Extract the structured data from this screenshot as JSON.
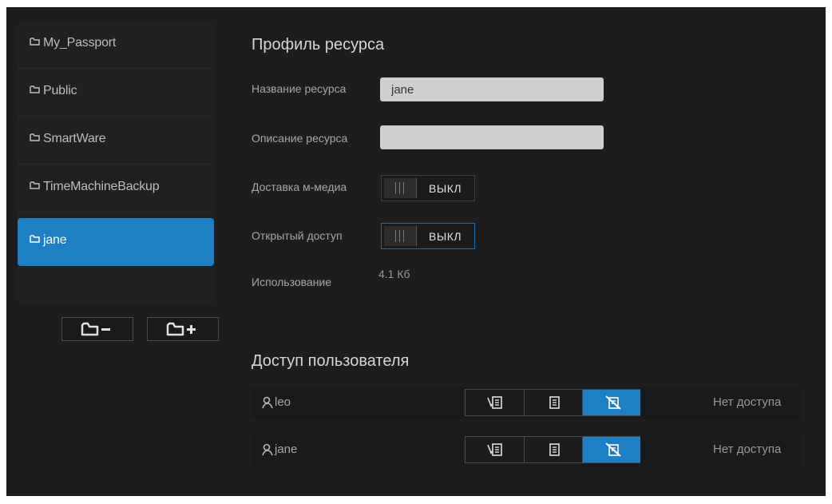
{
  "shares": [
    {
      "label": "My_Passport",
      "selected": false
    },
    {
      "label": "Public",
      "selected": false
    },
    {
      "label": "SmartWare",
      "selected": false
    },
    {
      "label": "TimeMachineBackup",
      "selected": false
    },
    {
      "label": "jane",
      "selected": true
    }
  ],
  "sidebar": {
    "remove_share_icon": "folder-minus-icon",
    "add_share_icon": "folder-plus-icon"
  },
  "profile": {
    "title": "Профиль ресурса",
    "name_label": "Название ресурса",
    "name_value": "jane",
    "description_label": "Описание ресурса",
    "description_value": "",
    "media_label": "Доставка м-медиа",
    "media_state": "ВЫКЛ",
    "public_label": "Открытый доступ",
    "public_state": "ВЫКЛ",
    "usage_label": "Использование",
    "usage_value": "4.1 Кб"
  },
  "access": {
    "title": "Доступ пользователя",
    "users": [
      {
        "name": "leo",
        "status": "Нет доступа",
        "selected_level": "no-access"
      },
      {
        "name": "jane",
        "status": "Нет доступа",
        "selected_level": "no-access"
      }
    ]
  },
  "colors": {
    "accent": "#1f7fc4",
    "background": "#1d1d1d"
  }
}
